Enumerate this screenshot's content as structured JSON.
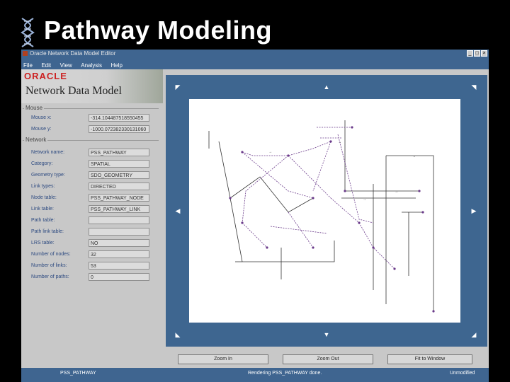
{
  "slide": {
    "title": "Pathway Modeling"
  },
  "window": {
    "title": "Oracle Network Data Model Editor",
    "controls": {
      "minimize": "_",
      "maximize": "□",
      "close": "×"
    }
  },
  "menu": [
    "File",
    "Edit",
    "View",
    "Analysis",
    "Help"
  ],
  "logo": {
    "brand": "ORACLE",
    "product": "Network Data Model"
  },
  "mouse": {
    "label": "Mouse",
    "fields": [
      {
        "label": "Mouse x:",
        "value": "-314.104487518550455"
      },
      {
        "label": "Mouse y:",
        "value": "-1000.072382330131060"
      }
    ]
  },
  "network": {
    "label": "Network",
    "fields": [
      {
        "label": "Network name:",
        "value": "PSS_PATHWAY"
      },
      {
        "label": "Category:",
        "value": "SPATIAL"
      },
      {
        "label": "Geometry type:",
        "value": "SDO_GEOMETRY"
      },
      {
        "label": "Link types:",
        "value": "DIRECTED"
      },
      {
        "label": "Node table:",
        "value": "PSS_PATHWAY_NODE"
      },
      {
        "label": "Link table:",
        "value": "PSS_PATHWAY_LINK"
      },
      {
        "label": "Path table:",
        "value": ""
      },
      {
        "label": "Path link table:",
        "value": ""
      },
      {
        "label": "LRS table:",
        "value": "NO"
      },
      {
        "label": "Number of nodes:",
        "value": "32"
      },
      {
        "label": "Number of links:",
        "value": "53"
      },
      {
        "label": "Number of paths:",
        "value": "0"
      }
    ]
  },
  "nav_arrows": {
    "nw": "◤",
    "n": "▲",
    "ne": "◥",
    "w": "◀",
    "e": "▶",
    "sw": "◣",
    "s": "▼",
    "se": "◢"
  },
  "buttons": {
    "zoom_in": "Zoom In",
    "zoom_out": "Zoom Out",
    "fit": "Fit to Window"
  },
  "status": {
    "left": "PSS_PATHWAY",
    "center": "Rendering PSS_PATHWAY done.",
    "right": "Unmodified"
  },
  "colors": {
    "window_blue": "#3f6590",
    "canvas_frame": "#3e6690",
    "panel_gray": "#c8c8c8",
    "oracle_red": "#cc2222",
    "link_purple": "#6a3a8a"
  }
}
